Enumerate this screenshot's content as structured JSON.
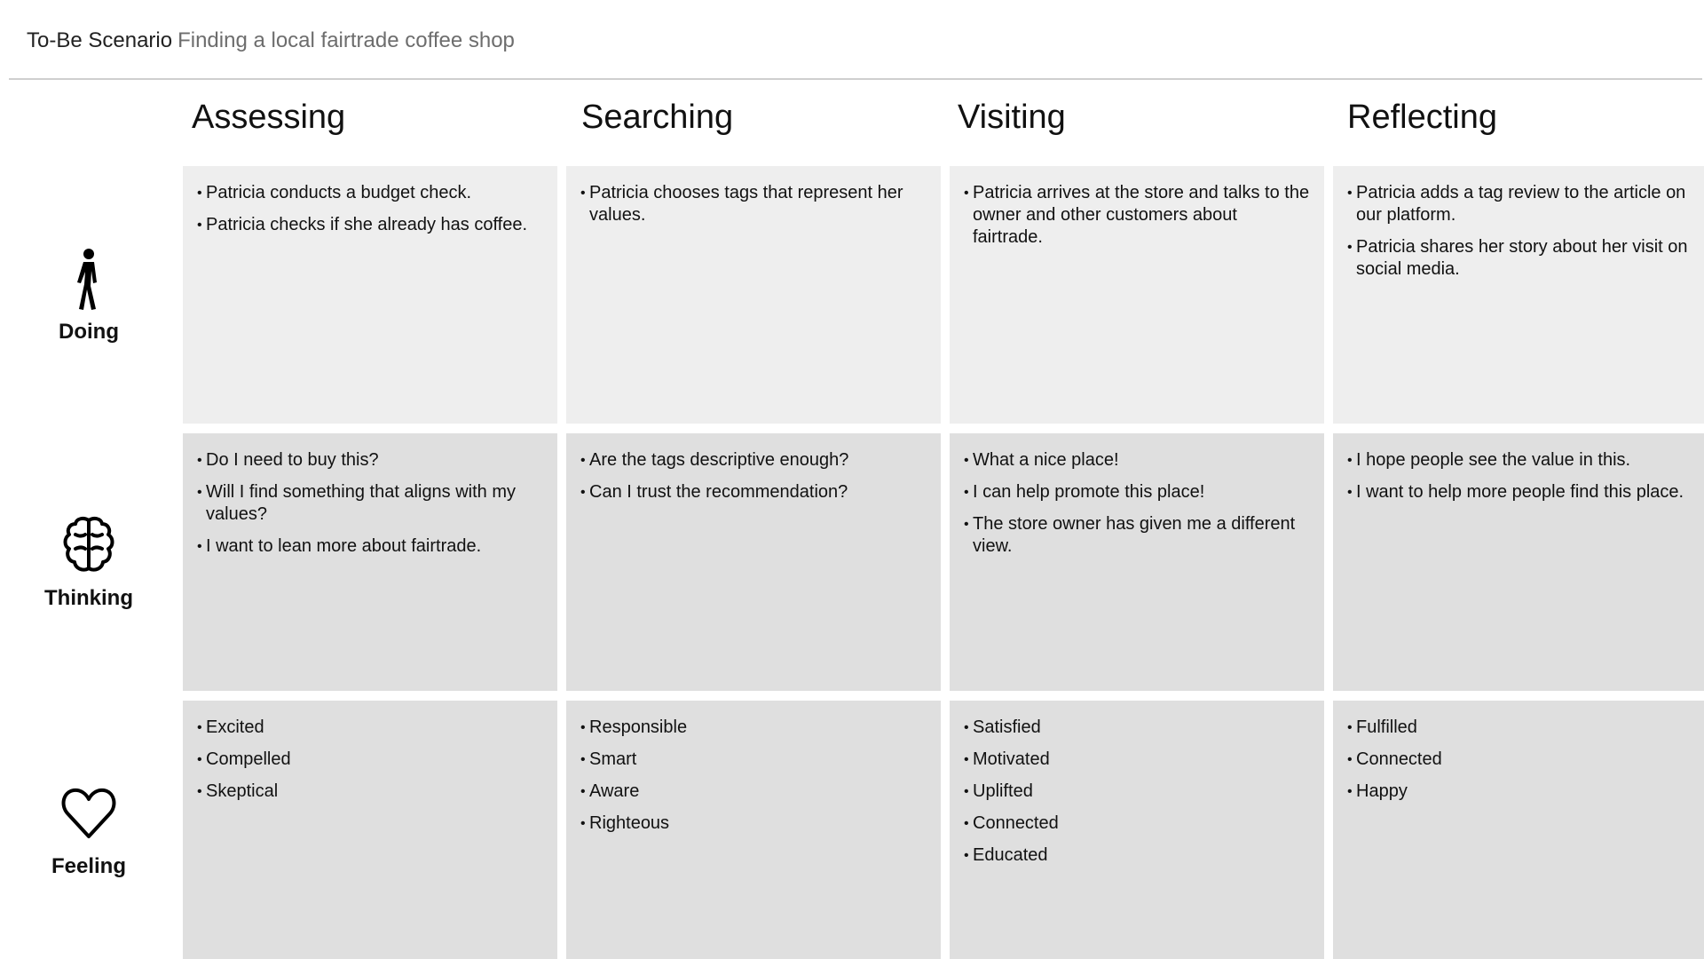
{
  "header": {
    "title": "To-Be Scenario",
    "subtitle": "Finding a local fairtrade coffee shop"
  },
  "phases": [
    "Assessing",
    "Searching",
    "Visiting",
    "Reflecting"
  ],
  "rows": [
    {
      "label": "Doing",
      "icon": "walking-person-icon",
      "cells": [
        [
          "Patricia conducts a budget check.",
          "Patricia checks if she already has coffee."
        ],
        [
          "Patricia chooses tags that represent her values."
        ],
        [
          "Patricia arrives at the store and talks to the owner and other customers about fairtrade."
        ],
        [
          "Patricia adds a tag review to the article on our platform.",
          "Patricia shares her story about her visit on social media."
        ]
      ]
    },
    {
      "label": "Thinking",
      "icon": "brain-icon",
      "cells": [
        [
          "Do I need to buy this?",
          "Will I find something that aligns with my values?",
          "I want to lean more about fairtrade."
        ],
        [
          "Are the tags descriptive enough?",
          "Can I trust the recommendation?"
        ],
        [
          "What a nice place!",
          "I can help promote this place!",
          "The store owner has given me a different view."
        ],
        [
          "I hope people see the value in this.",
          "I want to help more people find this place."
        ]
      ]
    },
    {
      "label": "Feeling",
      "icon": "heart-icon",
      "cells": [
        [
          "Excited",
          "Compelled",
          "Skeptical"
        ],
        [
          "Responsible",
          "Smart",
          "Aware",
          "Righteous"
        ],
        [
          "Satisfied",
          "Motivated",
          "Uplifted",
          "Connected",
          "Educated"
        ],
        [
          "Fulfilled",
          "Connected",
          "Happy"
        ]
      ]
    }
  ],
  "colors": {
    "doing_cell": "#eeeeee",
    "other_cell": "#dfdfdf",
    "divider": "#cfcfcf",
    "subtitle": "#6d6d6d"
  }
}
